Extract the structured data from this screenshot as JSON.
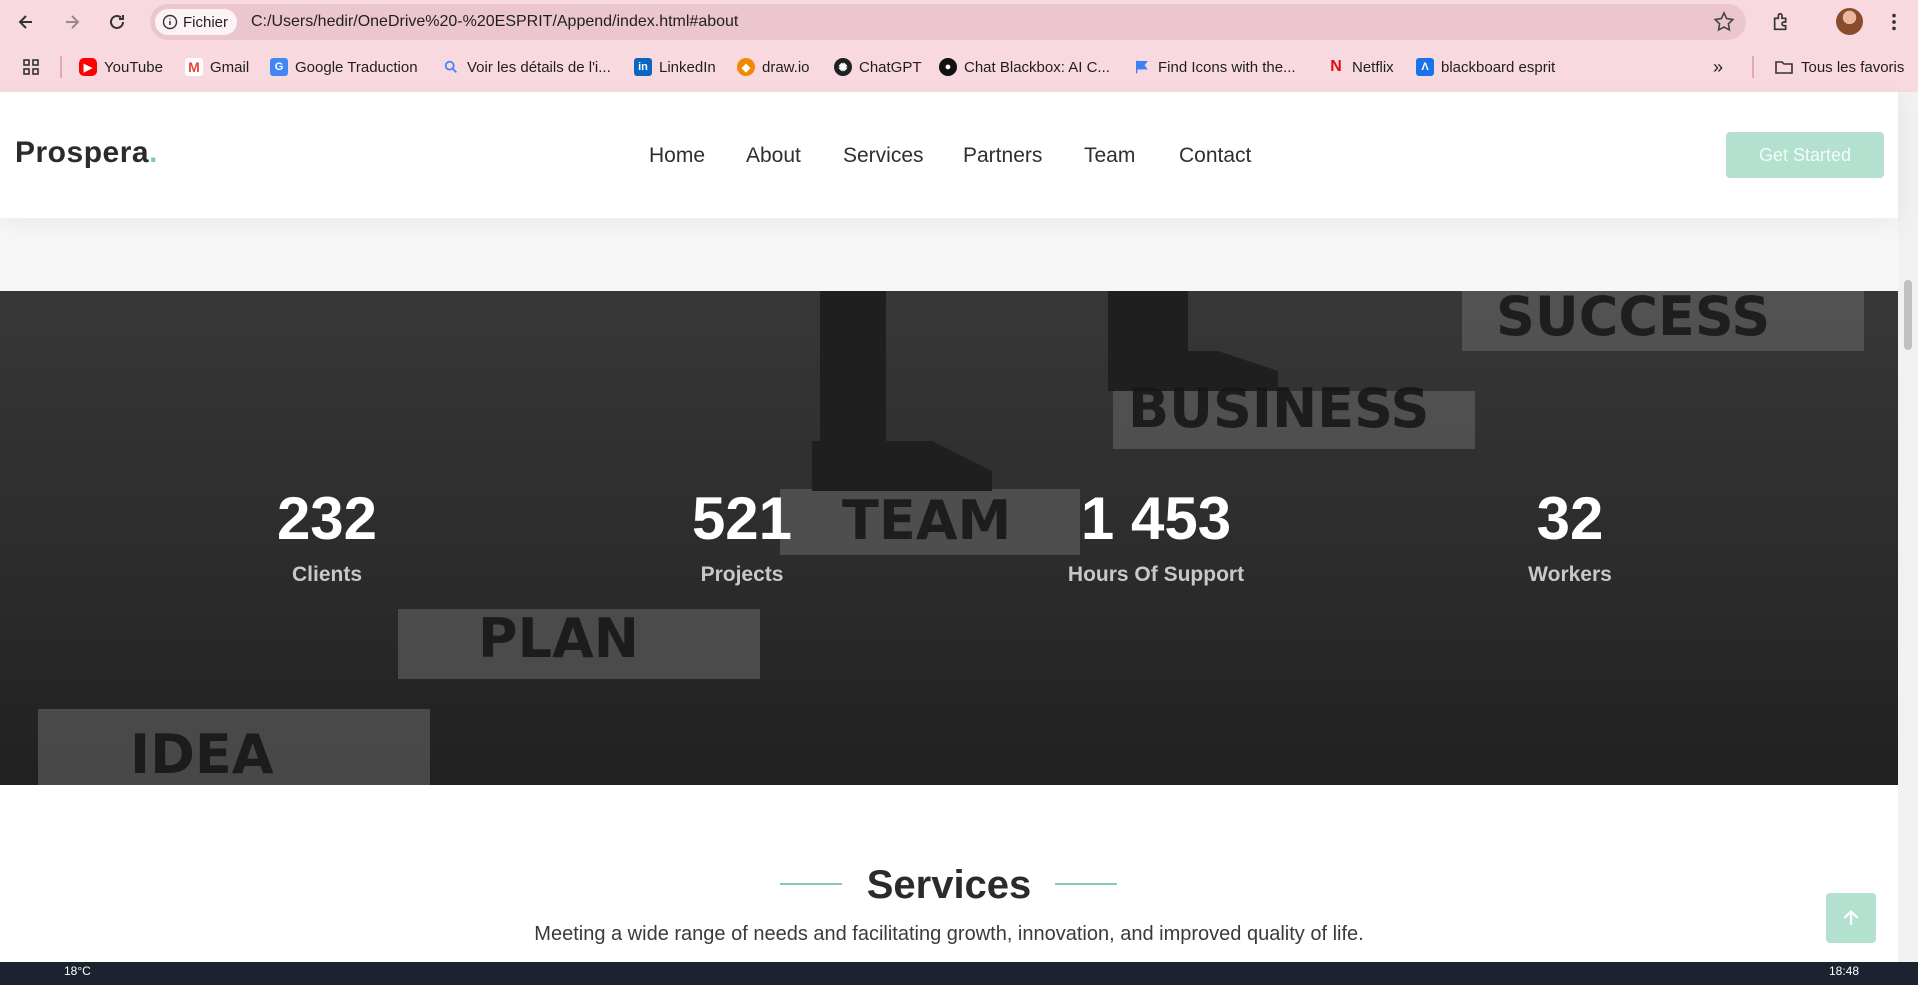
{
  "browser": {
    "site_chip": "Fichier",
    "url": "C:/Users/hedir/OneDrive%20-%20ESPRIT/Append/index.html#about",
    "bookmarks": [
      {
        "label": "YouTube",
        "icon": "youtube-icon",
        "color": "#ff0000"
      },
      {
        "label": "Gmail",
        "icon": "gmail-icon",
        "color": "#ea4335"
      },
      {
        "label": "Google Traduction",
        "icon": "translate-icon",
        "color": "#4285f4"
      },
      {
        "label": "Voir les détails de l'i...",
        "icon": "search-icon",
        "color": "#4285f4"
      },
      {
        "label": "LinkedIn",
        "icon": "linkedin-icon",
        "color": "#0a66c2"
      },
      {
        "label": "draw.io",
        "icon": "drawio-icon",
        "color": "#f08705"
      },
      {
        "label": "ChatGPT",
        "icon": "chatgpt-icon",
        "color": "#202123"
      },
      {
        "label": "Chat Blackbox: AI C...",
        "icon": "blackbox-icon",
        "color": "#111111"
      },
      {
        "label": "Find Icons with the...",
        "icon": "flag-icon",
        "color": "#3b82f6"
      },
      {
        "label": "Netflix",
        "icon": "netflix-icon",
        "color": "#e50914"
      },
      {
        "label": "blackboard esprit",
        "icon": "blackboard-icon",
        "color": "#1a73e8"
      }
    ],
    "all_bookmarks": "Tous les favoris"
  },
  "site": {
    "logo": "Prospera",
    "logo_dot": ".",
    "nav": [
      "Home",
      "About",
      "Services",
      "Partners",
      "Team",
      "Contact"
    ],
    "cta": "Get Started",
    "accent_color": "#b3e0cf"
  },
  "stats": [
    {
      "value": "232",
      "label": "Clients"
    },
    {
      "value": "521",
      "label": "Projects"
    },
    {
      "value": "1 453",
      "label": "Hours Of Support"
    },
    {
      "value": "32",
      "label": "Workers"
    }
  ],
  "background_words": [
    "SUCCESS",
    "BUSINESS",
    "TEAM",
    "PLAN",
    "IDEA"
  ],
  "services": {
    "title": "Services",
    "subtitle": "Meeting a wide range of needs and facilitating growth, innovation, and improved quality of life."
  },
  "taskbar": {
    "weather": "18°C",
    "time": "18:48"
  }
}
